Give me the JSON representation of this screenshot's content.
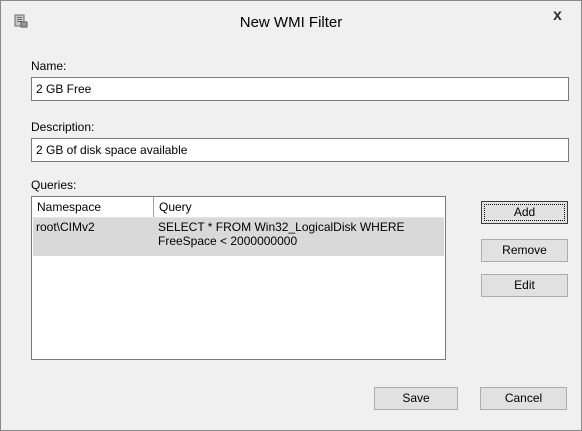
{
  "window": {
    "title": "New WMI Filter",
    "close_glyph": "x",
    "app_icon": "filter-app-icon"
  },
  "name": {
    "label": "Name:",
    "value": "2 GB Free"
  },
  "description": {
    "label": "Description:",
    "value": "2 GB of disk space available"
  },
  "queries": {
    "label": "Queries:",
    "columns": [
      "Namespace",
      "Query"
    ],
    "rows": [
      {
        "namespace": "root\\CIMv2",
        "query": "SELECT * FROM Win32_LogicalDisk WHERE FreeSpace < 2000000000"
      }
    ]
  },
  "side_buttons": {
    "add": "Add",
    "remove": "Remove",
    "edit": "Edit"
  },
  "footer_buttons": {
    "save": "Save",
    "cancel": "Cancel"
  }
}
